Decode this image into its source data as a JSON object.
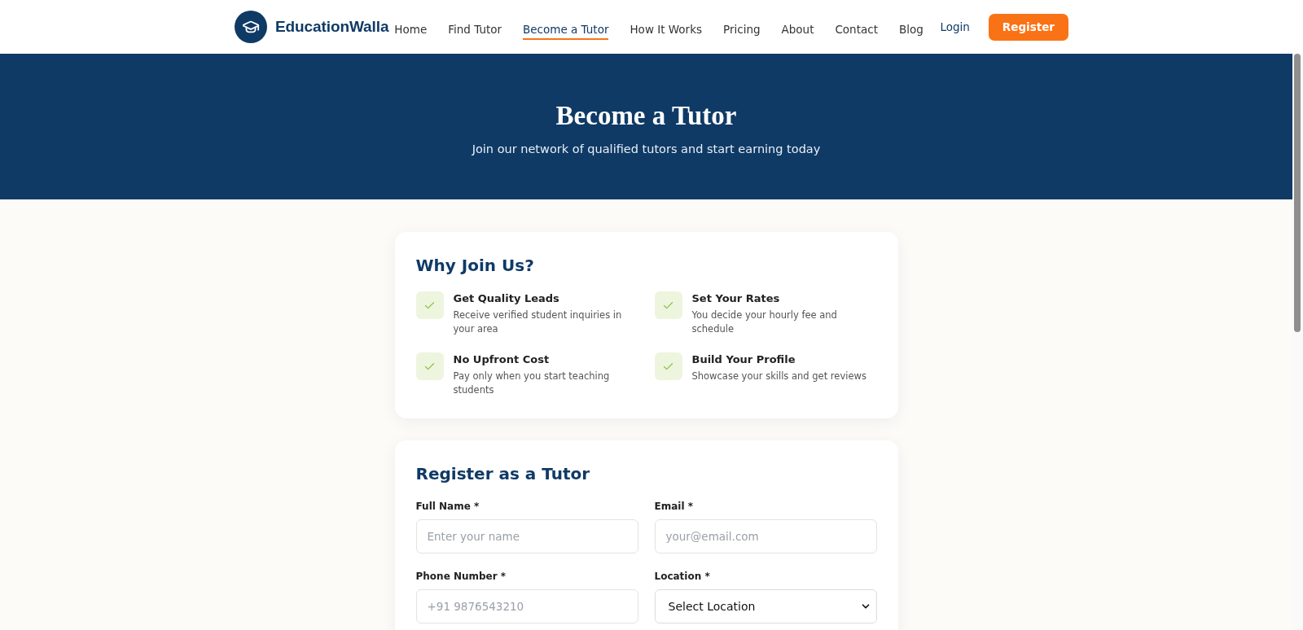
{
  "brand": {
    "name": "EducationWalla"
  },
  "nav": {
    "links": [
      {
        "label": "Home",
        "selected": false
      },
      {
        "label": "Find Tutor",
        "selected": false
      },
      {
        "label": "Become a Tutor",
        "selected": true
      },
      {
        "label": "How It Works",
        "selected": false
      },
      {
        "label": "Pricing",
        "selected": false
      },
      {
        "label": "About",
        "selected": false
      },
      {
        "label": "Contact",
        "selected": false
      },
      {
        "label": "Blog",
        "selected": false
      }
    ],
    "login": "Login",
    "register": "Register"
  },
  "hero": {
    "title": "Become a Tutor",
    "subtitle": "Join our network of qualified tutors and start earning today"
  },
  "benefits": {
    "title": "Why Join Us?",
    "items": [
      {
        "title": "Get Quality Leads",
        "description": "Receive verified student inquiries in your area"
      },
      {
        "title": "Set Your Rates",
        "description": "You decide your hourly fee and schedule"
      },
      {
        "title": "No Upfront Cost",
        "description": "Pay only when you start teaching students"
      },
      {
        "title": "Build Your Profile",
        "description": "Showcase your skills and get reviews"
      }
    ]
  },
  "registration_form": {
    "title": "Register as a Tutor",
    "fields": [
      {
        "kind": "text",
        "label": "Full Name *",
        "placeholder": "Enter your name"
      },
      {
        "kind": "text",
        "label": "Email *",
        "placeholder": "your@email.com"
      },
      {
        "kind": "text",
        "label": "Phone Number *",
        "placeholder": "+91 9876543210"
      },
      {
        "kind": "select",
        "label": "Location *",
        "value": "Select Location"
      }
    ]
  }
}
